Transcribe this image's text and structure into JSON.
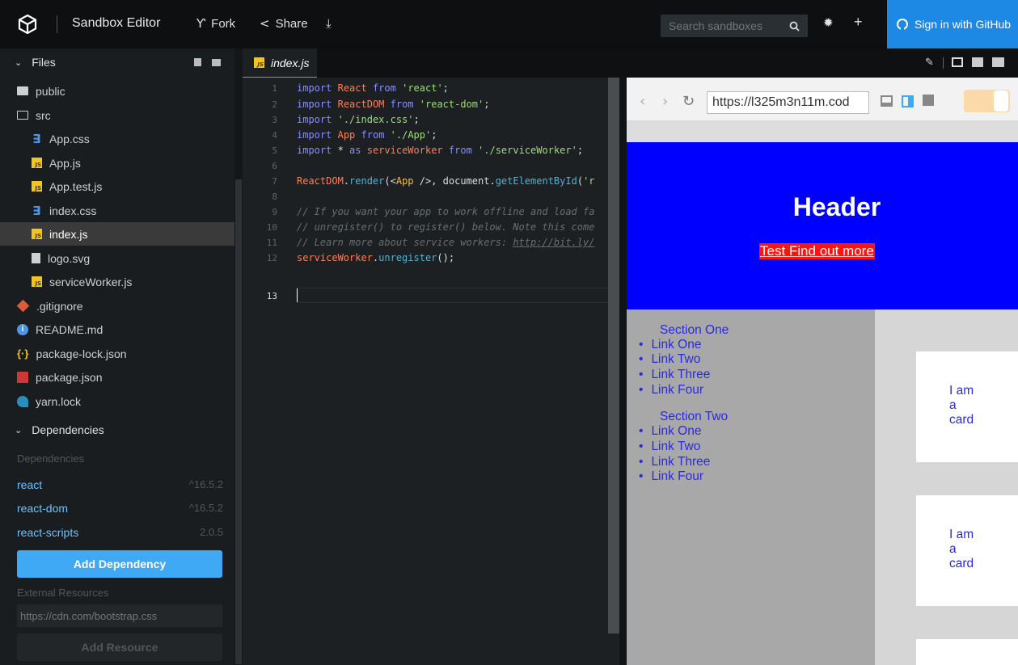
{
  "app": {
    "title": "Sandbox Editor"
  },
  "toolbar": {
    "fork": "Fork",
    "share": "Share",
    "download_icon": "download-icon",
    "settings_icon": "gear-icon",
    "add_icon": "plus-icon"
  },
  "search": {
    "placeholder": "Search sandboxes"
  },
  "signin": {
    "label": "Sign in with GitHub"
  },
  "sidebar": {
    "files_header": "Files",
    "files": [
      {
        "name": "public",
        "icon": "folder-icon"
      },
      {
        "name": "src",
        "icon": "folder-open-icon"
      },
      {
        "name": "App.css",
        "icon": "css-icon"
      },
      {
        "name": "App.js",
        "icon": "js-icon"
      },
      {
        "name": "App.test.js",
        "icon": "js-icon"
      },
      {
        "name": "index.css",
        "icon": "css-icon"
      },
      {
        "name": "index.js",
        "icon": "js-icon",
        "active": true
      },
      {
        "name": "logo.svg",
        "icon": "file-icon"
      },
      {
        "name": "serviceWorker.js",
        "icon": "js-icon"
      },
      {
        "name": ".gitignore",
        "icon": "git-icon"
      },
      {
        "name": "README.md",
        "icon": "info-icon"
      },
      {
        "name": "package-lock.json",
        "icon": "json-icon"
      },
      {
        "name": "package.json",
        "icon": "npm-icon"
      },
      {
        "name": "yarn.lock",
        "icon": "yarn-icon"
      }
    ],
    "deps_header": "Dependencies",
    "deps_label": "Dependencies",
    "deps": [
      {
        "name": "react",
        "version": "^16.5.2"
      },
      {
        "name": "react-dom",
        "version": "^16.5.2"
      },
      {
        "name": "react-scripts",
        "version": "2.0.5"
      }
    ],
    "add_dependency": "Add Dependency",
    "external_label": "External Resources",
    "external_placeholder": "https://cdn.com/bootstrap.css",
    "add_resource": "Add Resource"
  },
  "editor": {
    "tab": "index.js",
    "line_numbers": [
      "1",
      "2",
      "3",
      "4",
      "5",
      "6",
      "7",
      "8",
      "9",
      "10",
      "11",
      "12",
      "13"
    ],
    "current_line": 13
  },
  "preview": {
    "url": "https://l325m3n11m.cod",
    "header_title": "Header",
    "header_link": "Test Find out more",
    "sections": [
      {
        "title": "Section One",
        "links": [
          "Link One",
          "Link Two",
          "Link Three",
          "Link Four"
        ]
      },
      {
        "title": "Section Two",
        "links": [
          "Link One",
          "Link Two",
          "Link Three",
          "Link Four"
        ]
      }
    ],
    "card_text": "I am a card"
  },
  "colors": {
    "accent": "#40a9f3",
    "signin": "#1e88e5",
    "preview_header": "#0000ff",
    "link_bg": "#ff1414"
  }
}
